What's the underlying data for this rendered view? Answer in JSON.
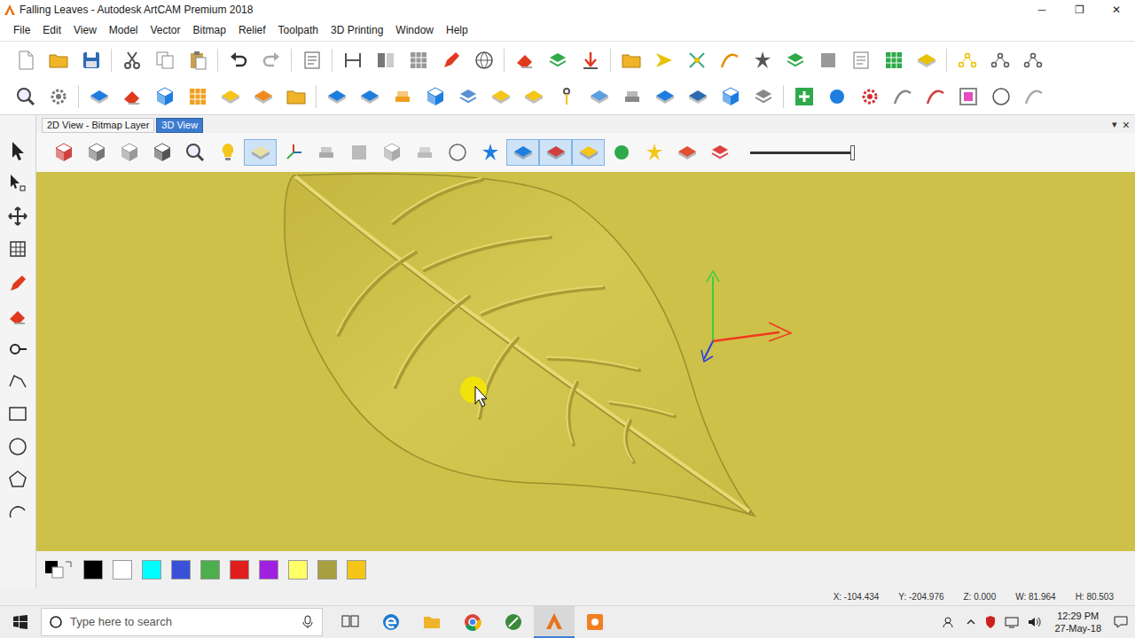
{
  "window": {
    "title": "Falling Leaves - Autodesk ArtCAM Premium 2018",
    "controls": [
      "─",
      "❐",
      "✕"
    ]
  },
  "menu": [
    "File",
    "Edit",
    "View",
    "Model",
    "Vector",
    "Bitmap",
    "Relief",
    "Toolpath",
    "3D Printing",
    "Window",
    "Help"
  ],
  "tabs": [
    {
      "label": "2D View - Bitmap Layer",
      "selected": false
    },
    {
      "label": "3D View",
      "selected": true
    }
  ],
  "tab_controls": {
    "dropdown": "▾",
    "close": "×"
  },
  "view_toolbar": {
    "slider": {
      "level": 1.0
    }
  },
  "palette": [
    {
      "color": "#000000"
    },
    {
      "color": "#ffffff"
    },
    {
      "color": "#00ffff"
    },
    {
      "color": "#3a50d8"
    },
    {
      "color": "#4cae4c"
    },
    {
      "color": "#e01e1e"
    },
    {
      "color": "#a020e0"
    },
    {
      "color": "#ffff66"
    },
    {
      "color": "#a8a040"
    },
    {
      "color": "#f5c518"
    }
  ],
  "status_bar": [
    "X: -104.434",
    "Y: -204.976",
    "Z: 0.000",
    "W: 81.964",
    "H: 80.503"
  ],
  "taskbar": {
    "search_placeholder": "Type here to search",
    "time": "12:29 PM",
    "date": "27-May-18"
  }
}
